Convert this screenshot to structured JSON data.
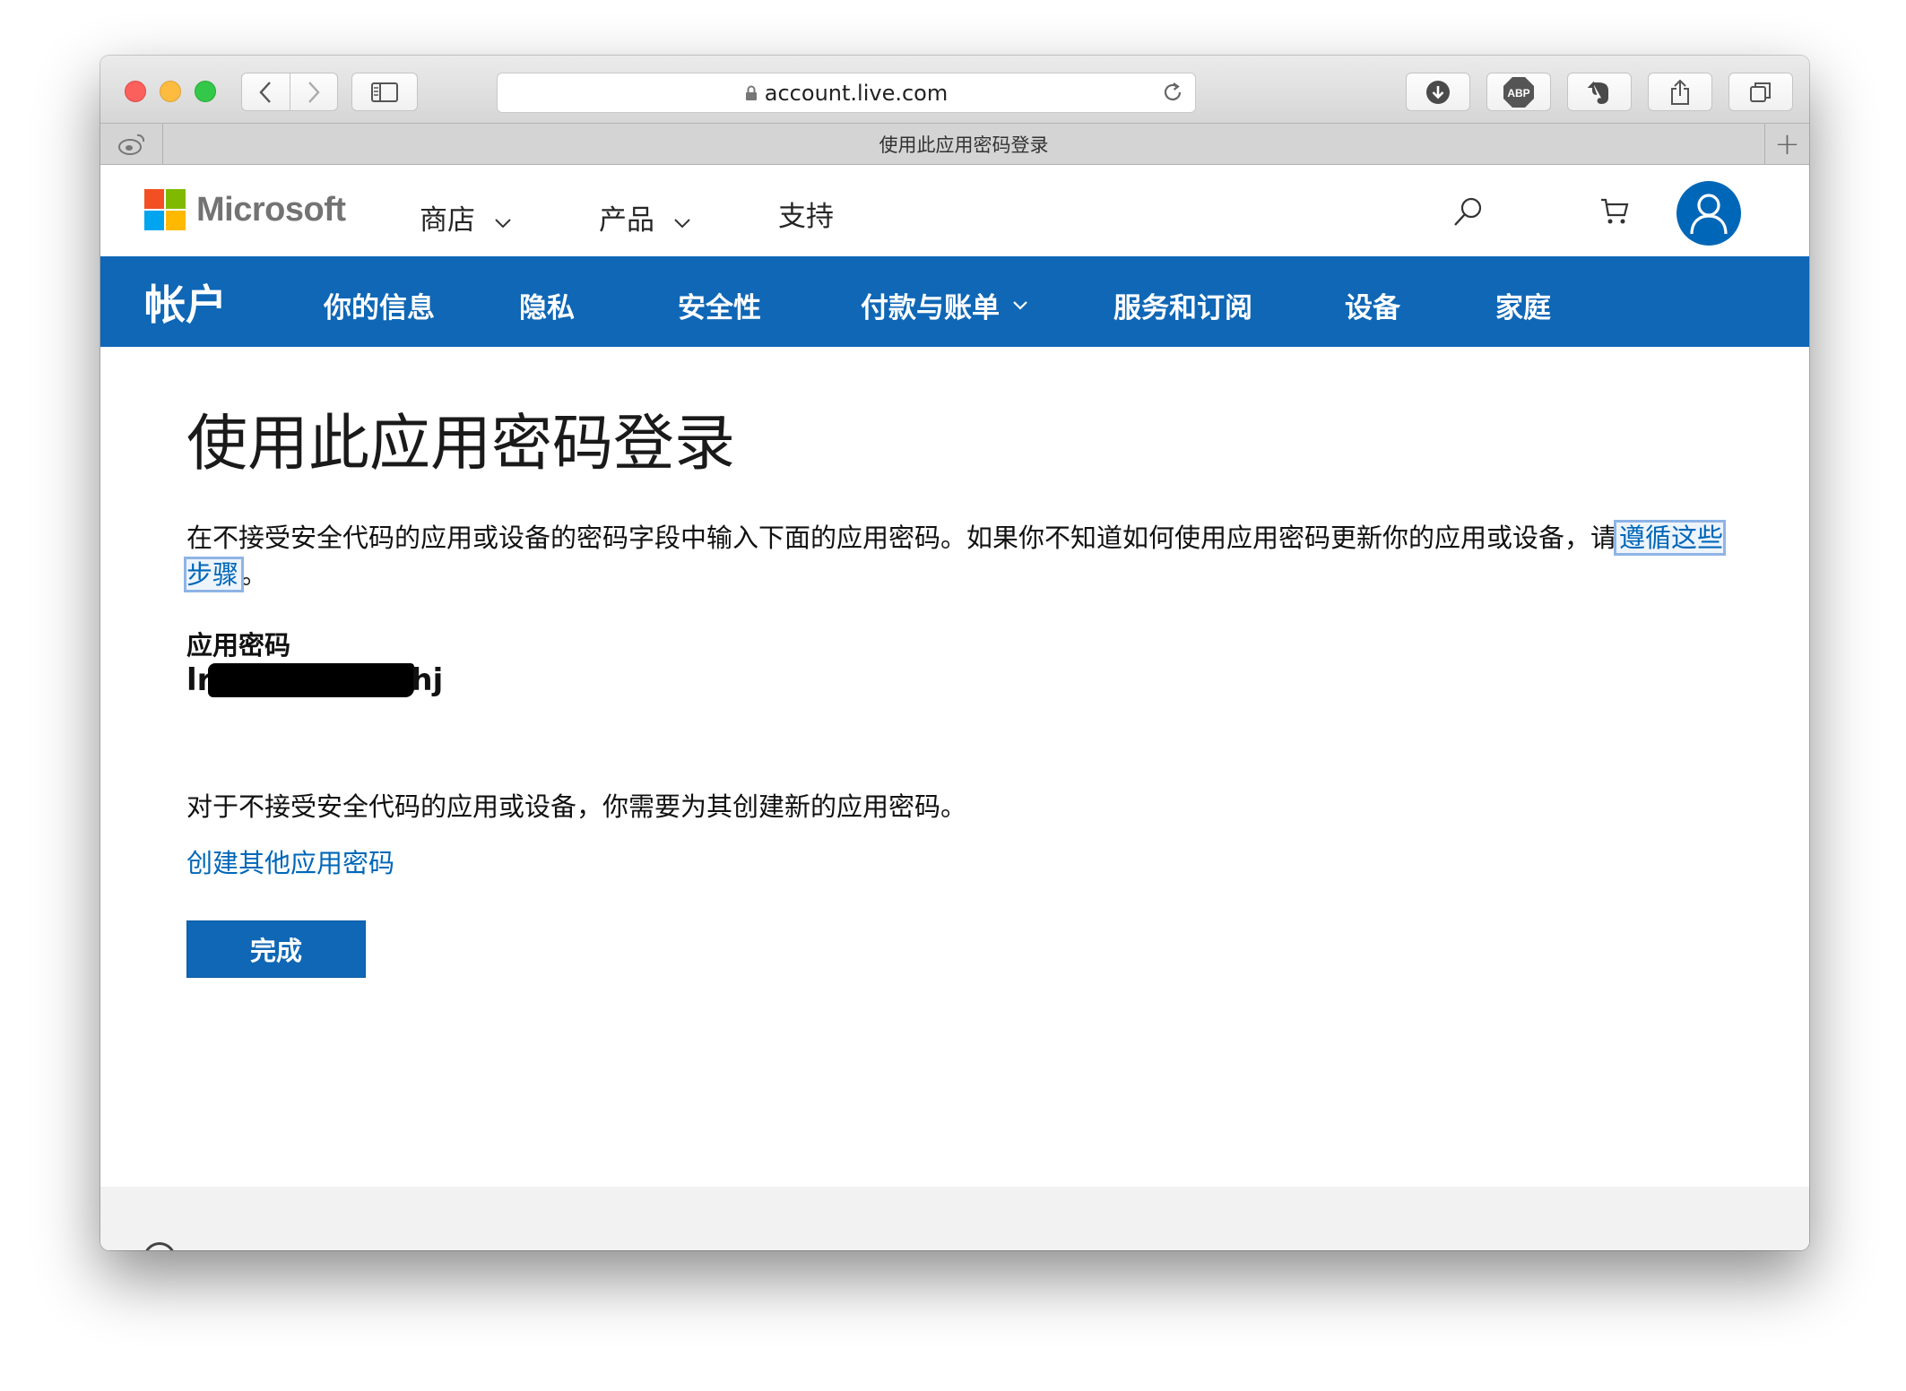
{
  "browser": {
    "url": "account.live.com",
    "tab_title": "使用此应用密码登录",
    "new_tab_symbol": "+",
    "abp_label": "ABP"
  },
  "header": {
    "logo_text": "Microsoft",
    "logo_colors": [
      "#f25022",
      "#7fba00",
      "#00a4ef",
      "#ffb900"
    ],
    "nav": [
      {
        "label": "商店",
        "has_dropdown": true
      },
      {
        "label": "产品",
        "has_dropdown": true
      },
      {
        "label": "支持",
        "has_dropdown": false
      }
    ]
  },
  "account_nav": {
    "brand": "帐户",
    "items": [
      {
        "label": "你的信息"
      },
      {
        "label": "隐私"
      },
      {
        "label": "安全性"
      },
      {
        "label": "付款与账单",
        "has_dropdown": true
      },
      {
        "label": "服务和订阅"
      },
      {
        "label": "设备"
      },
      {
        "label": "家庭"
      }
    ],
    "background": "#0f67b6"
  },
  "main": {
    "title": "使用此应用密码登录",
    "intro_text": "在不接受安全代码的应用或设备的密码字段中输入下面的应用密码。如果你不知道如何使用应用密码更新你的应用或设备，请",
    "intro_link": "遵循这些步骤",
    "intro_end": "。",
    "password_label": "应用密码",
    "password_prefix": "lr",
    "password_suffix": "hj",
    "note": "对于不接受安全代码的应用或设备，你需要为其创建新的应用密码。",
    "create_link": "创建其他应用密码",
    "done_button": "完成"
  },
  "colors": {
    "accent": "#0067b8",
    "link": "#0067b8"
  }
}
